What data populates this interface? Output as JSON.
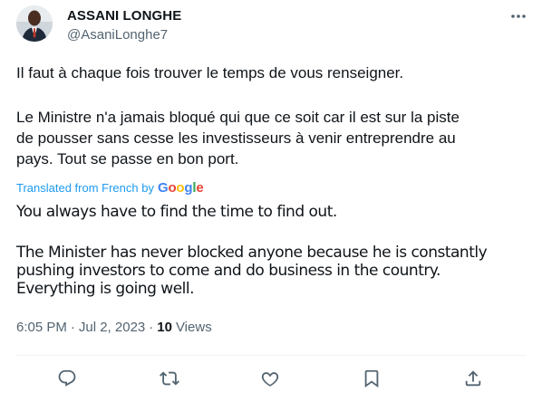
{
  "author": {
    "name": "ASSANI LONGHE",
    "handle": "@AsaniLonghe7"
  },
  "tweet": {
    "original_p1": "Il faut à chaque fois trouver le temps de vous renseigner.",
    "original_p2": "Le Ministre n'a jamais bloqué qui que ce soit car il est sur la piste\nde pousser sans cesse les investisseurs à venir entreprendre au\npays. Tout se passe en bon port.",
    "translated_label": "Translated from French by",
    "google_logo": "Google",
    "translation_p1": "You always have to find the time to find out.",
    "translation_p2": "The Minister has never blocked anyone because he is constantly\npushing investors to come and do business in the country.\nEverything is going well."
  },
  "meta": {
    "time": "6:05 PM",
    "separator": "·",
    "date": "Jul 2, 2023",
    "views_count": "10",
    "views_label": "Views"
  },
  "icons": {
    "more": "more-icon",
    "reply": "reply-icon",
    "retweet": "retweet-icon",
    "like": "like-icon",
    "bookmark": "bookmark-icon",
    "share": "share-icon"
  },
  "colors": {
    "text": "#0f1419",
    "secondary": "#536471",
    "link": "#1d9bf0",
    "divider": "#eff3f4"
  }
}
